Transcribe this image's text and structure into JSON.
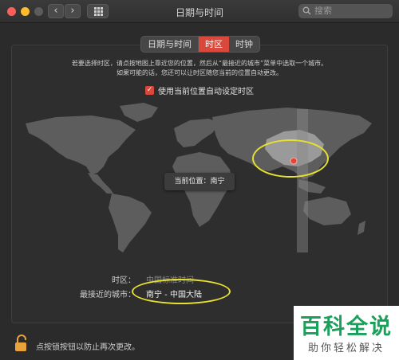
{
  "window": {
    "title": "日期与时间"
  },
  "search": {
    "placeholder": "搜索"
  },
  "tabs": [
    {
      "label": "日期与时间",
      "active": false
    },
    {
      "label": "时区",
      "active": true
    },
    {
      "label": "时钟",
      "active": false
    }
  ],
  "instructions": {
    "line1": "若要选择时区，请点按地图上靠近您的位置，然后从“最接近的城市”菜单中选取一个城市。",
    "line2": "如果可能的话，您还可以让时区随您当前的位置自动更改。"
  },
  "auto_timezone": {
    "label": "使用当前位置自动设定时区",
    "checked": true
  },
  "map": {
    "tooltip": "当前位置：南宁"
  },
  "timezone": {
    "label": "时区：",
    "value": "中国标准时间"
  },
  "closest_city": {
    "label": "最接近的城市：",
    "value": "南宁 - 中国大陆"
  },
  "lock": {
    "text": "点按锁按钮以防止再次更改。"
  },
  "watermark": {
    "big": "百科全说",
    "small": "助你轻松解决"
  },
  "colors": {
    "accent": "#d9483b",
    "annotation": "#e8e030",
    "watermark": "#1aa05a"
  }
}
